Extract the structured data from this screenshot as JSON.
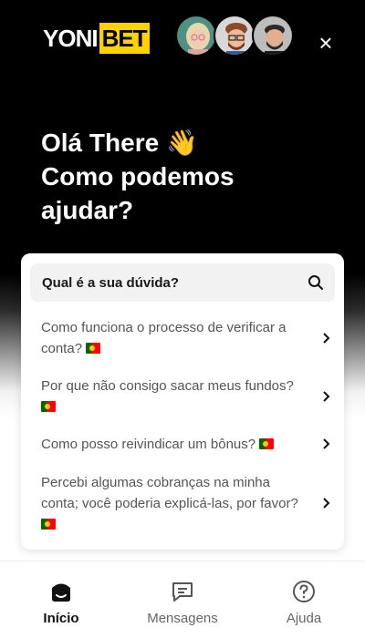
{
  "header": {
    "logo_left": "YONI",
    "logo_right": "BET",
    "close_glyph": "×"
  },
  "greeting": {
    "line1": "Olá There",
    "wave_emoji": "👋",
    "line2": "Como podemos",
    "line3": "ajudar?"
  },
  "search": {
    "label": "Qual é a sua dúvida?",
    "icon": "search-icon"
  },
  "faq": [
    {
      "text": "Como funciona o processo de verificar a conta?"
    },
    {
      "text": "Por que não consigo sacar meus fundos?"
    },
    {
      "text": "Como posso reivindicar um bônus?"
    },
    {
      "text": "Percebi algumas cobranças na minha conta; você poderia explicá-las, por favor?"
    }
  ],
  "nav": {
    "items": [
      {
        "label": "Início",
        "icon": "home-icon",
        "active": true
      },
      {
        "label": "Mensagens",
        "icon": "messages-icon",
        "active": false
      },
      {
        "label": "Ajuda",
        "icon": "help-icon",
        "active": false
      }
    ]
  },
  "colors": {
    "brand_yellow": "#ffd200",
    "hero_bg": "#000000",
    "text_muted": "#555555"
  }
}
